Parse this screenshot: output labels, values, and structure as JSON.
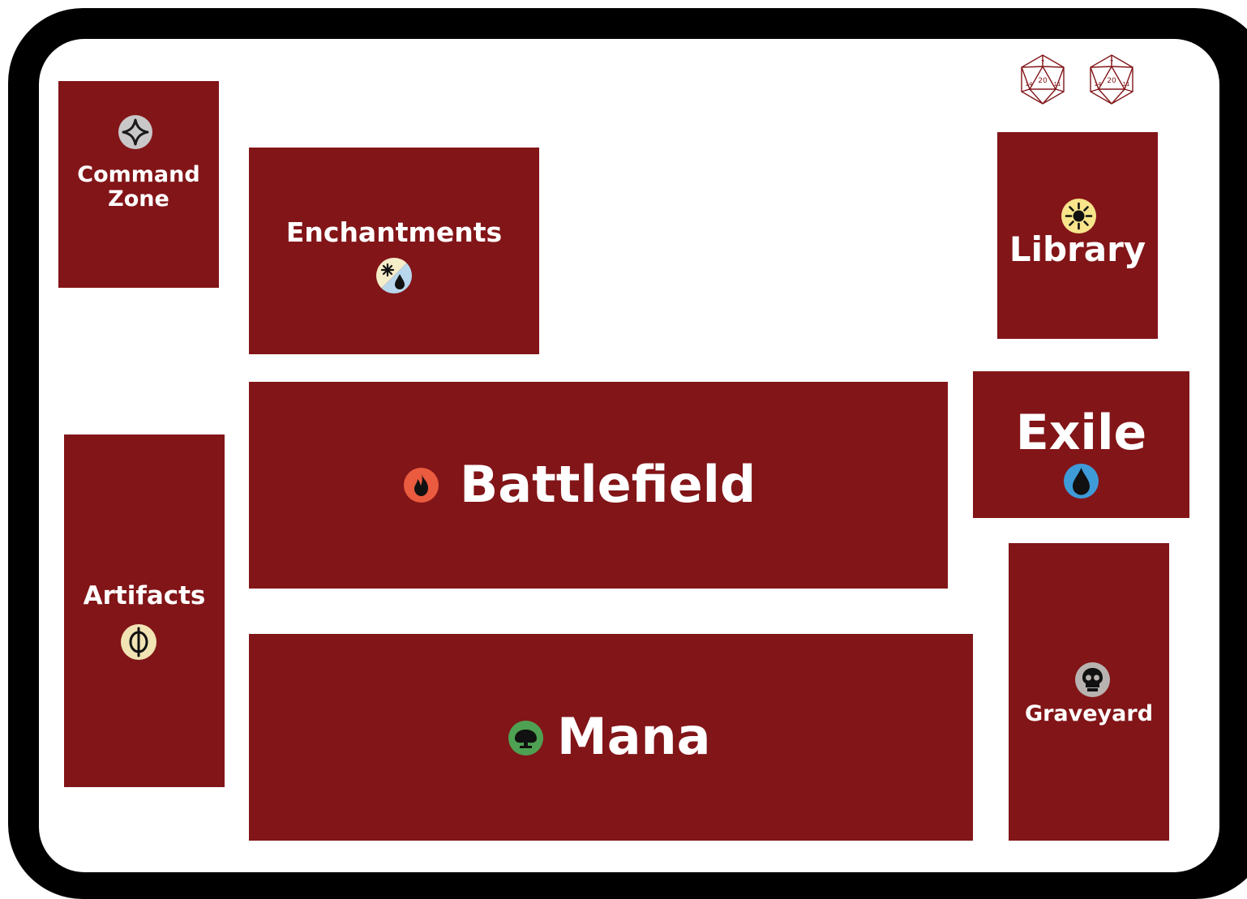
{
  "zones": {
    "command": {
      "label_line1": "Command",
      "label_line2": "Zone",
      "icon": "planeswalker-icon"
    },
    "enchantments": {
      "label": "Enchantments",
      "icon": "white-blue-hybrid-mana-icon"
    },
    "library": {
      "label": "Library",
      "icon": "white-mana-sun-icon"
    },
    "artifacts": {
      "label": "Artifacts",
      "icon": "phyrexian-mana-icon"
    },
    "battlefield": {
      "label": "Battlefield",
      "icon": "red-mana-fire-icon"
    },
    "exile": {
      "label": "Exile",
      "icon": "blue-mana-drop-icon"
    },
    "mana": {
      "label": "Mana",
      "icon": "green-mana-tree-icon"
    },
    "graveyard": {
      "label": "Graveyard",
      "icon": "black-mana-skull-icon"
    }
  },
  "dice": [
    {
      "icon": "d20-icon",
      "faces": [
        "20",
        "7",
        "14",
        "11"
      ]
    },
    {
      "icon": "d20-icon",
      "faces": [
        "20",
        "7",
        "14",
        "11"
      ]
    }
  ],
  "colors": {
    "zone": "#821518",
    "frame": "#000000",
    "mat": "#ffffff",
    "text": "#ffffff",
    "dice": "#821518"
  }
}
